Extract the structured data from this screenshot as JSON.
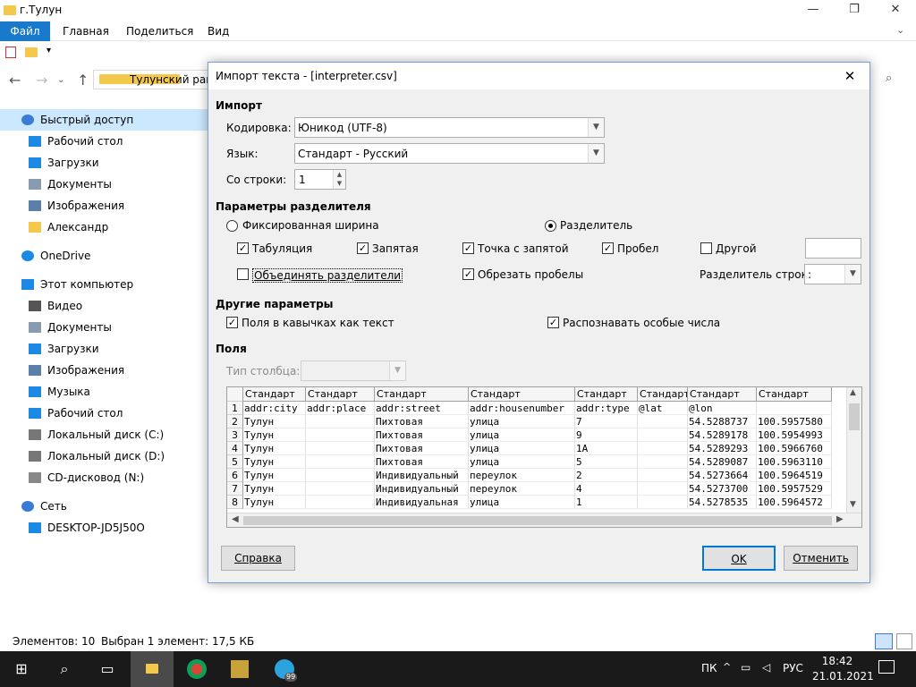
{
  "explorer": {
    "window_title": "г.Тулун",
    "ribbon_tabs": [
      "Файл",
      "Главная",
      "Поделиться",
      "Вид"
    ],
    "address_text": "Тулунский райо",
    "sidebar": [
      {
        "label": "Быстрый доступ",
        "icon": "star-icon",
        "level": 0,
        "selected": true
      },
      {
        "label": "Рабочий стол",
        "icon": "desktop-icon",
        "level": 1
      },
      {
        "label": "Загрузки",
        "icon": "download-icon",
        "level": 1
      },
      {
        "label": "Документы",
        "icon": "documents-icon",
        "level": 1
      },
      {
        "label": "Изображения",
        "icon": "pictures-icon",
        "level": 1
      },
      {
        "label": "Александр",
        "icon": "folder-icon",
        "level": 1
      },
      {
        "label": "OneDrive",
        "icon": "cloud-icon",
        "level": 0
      },
      {
        "label": "Этот компьютер",
        "icon": "computer-icon",
        "level": 0
      },
      {
        "label": "Видео",
        "icon": "video-icon",
        "level": 1
      },
      {
        "label": "Документы",
        "icon": "documents-icon",
        "level": 1
      },
      {
        "label": "Загрузки",
        "icon": "download-icon",
        "level": 1
      },
      {
        "label": "Изображения",
        "icon": "pictures-icon",
        "level": 1
      },
      {
        "label": "Музыка",
        "icon": "music-icon",
        "level": 1
      },
      {
        "label": "Рабочий стол",
        "icon": "desktop-icon",
        "level": 1
      },
      {
        "label": "Локальный диск (C:)",
        "icon": "drive-icon",
        "level": 1
      },
      {
        "label": "Локальный диск (D:)",
        "icon": "drive-icon",
        "level": 1
      },
      {
        "label": "CD-дисковод (N:)",
        "icon": "cd-drive-icon",
        "level": 1
      },
      {
        "label": "Сеть",
        "icon": "network-icon",
        "level": 0
      },
      {
        "label": "DESKTOP-JD5J50O",
        "icon": "computer-icon",
        "level": 1
      }
    ],
    "status_count": "Элементов: 10",
    "status_selected": "Выбран 1 элемент: 17,5 КБ"
  },
  "dialog": {
    "title": "Импорт текста - [interpreter.csv]",
    "section_import": "Импорт",
    "encoding_label": "Кодировка:",
    "encoding_value": "Юникод (UTF-8)",
    "language_label": "Язык:",
    "language_value": "Стандарт - Русский",
    "from_row_label": "Со строки:",
    "from_row_value": "1",
    "section_separator": "Параметры разделителя",
    "fixed_width_label": "Фиксированная ширина",
    "separated_label": "Разделитель",
    "separator_mode": "separated",
    "opt_tab": {
      "label": "Табуляция",
      "checked": true
    },
    "opt_comma": {
      "label": "Запятая",
      "checked": true
    },
    "opt_semicolon": {
      "label": "Точка с запятой",
      "checked": true
    },
    "opt_space": {
      "label": "Пробел",
      "checked": true
    },
    "opt_other": {
      "label": "Другой",
      "checked": false
    },
    "other_value": "",
    "opt_merge": {
      "label": "Объединять разделители",
      "checked": false
    },
    "opt_trim": {
      "label": "Обрезать пробелы",
      "checked": true
    },
    "string_delim_label": "Разделитель строк:",
    "string_delim_value": ":",
    "section_other": "Другие параметры",
    "opt_quoted": {
      "label": "Поля в кавычках как текст",
      "checked": true
    },
    "opt_special": {
      "label": "Распознавать особые числа",
      "checked": true
    },
    "section_fields": "Поля",
    "column_type_label": "Тип столбца:",
    "column_type_value": "",
    "help_button": "Справка",
    "ok_button": "OK",
    "cancel_button": "Отменить"
  },
  "preview": {
    "column_types": [
      "Стандарт",
      "Стандарт",
      "Стандарт",
      "Стандарт",
      "Стандарт",
      "Стандарт",
      "Стандарт",
      "Стандарт"
    ],
    "row_numbers": [
      "1",
      "2",
      "3",
      "4",
      "5",
      "6",
      "7",
      "8"
    ],
    "rows": [
      [
        "addr:city",
        "addr:place",
        "addr:street",
        "addr:housenumber",
        "addr:type",
        "@lat",
        "@lon",
        ""
      ],
      [
        "Тулун",
        "",
        "Пихтовая",
        "улица",
        "7",
        "",
        "54.5288737",
        "100.5957580"
      ],
      [
        "Тулун",
        "",
        "Пихтовая",
        "улица",
        "9",
        "",
        "54.5289178",
        "100.5954993"
      ],
      [
        "Тулун",
        "",
        "Пихтовая",
        "улица",
        "1А",
        "",
        "54.5289293",
        "100.5966760"
      ],
      [
        "Тулун",
        "",
        "Пихтовая",
        "улица",
        "5",
        "",
        "54.5289087",
        "100.5963110"
      ],
      [
        "Тулун",
        "",
        "Индивидуальный",
        "переулок",
        "2",
        "",
        "54.5273664",
        "100.5964519"
      ],
      [
        "Тулун",
        "",
        "Индивидуальный",
        "переулок",
        "4",
        "",
        "54.5273700",
        "100.5957529"
      ],
      [
        "Тулун",
        "",
        "Индивидуальная",
        "улица",
        "1",
        "",
        "54.5278535",
        "100.5964572"
      ]
    ]
  },
  "taskbar": {
    "lang_short": "ПК",
    "lang": "РУС",
    "time": "18:42",
    "date": "21.01.2021",
    "telegram_badge": "99"
  }
}
